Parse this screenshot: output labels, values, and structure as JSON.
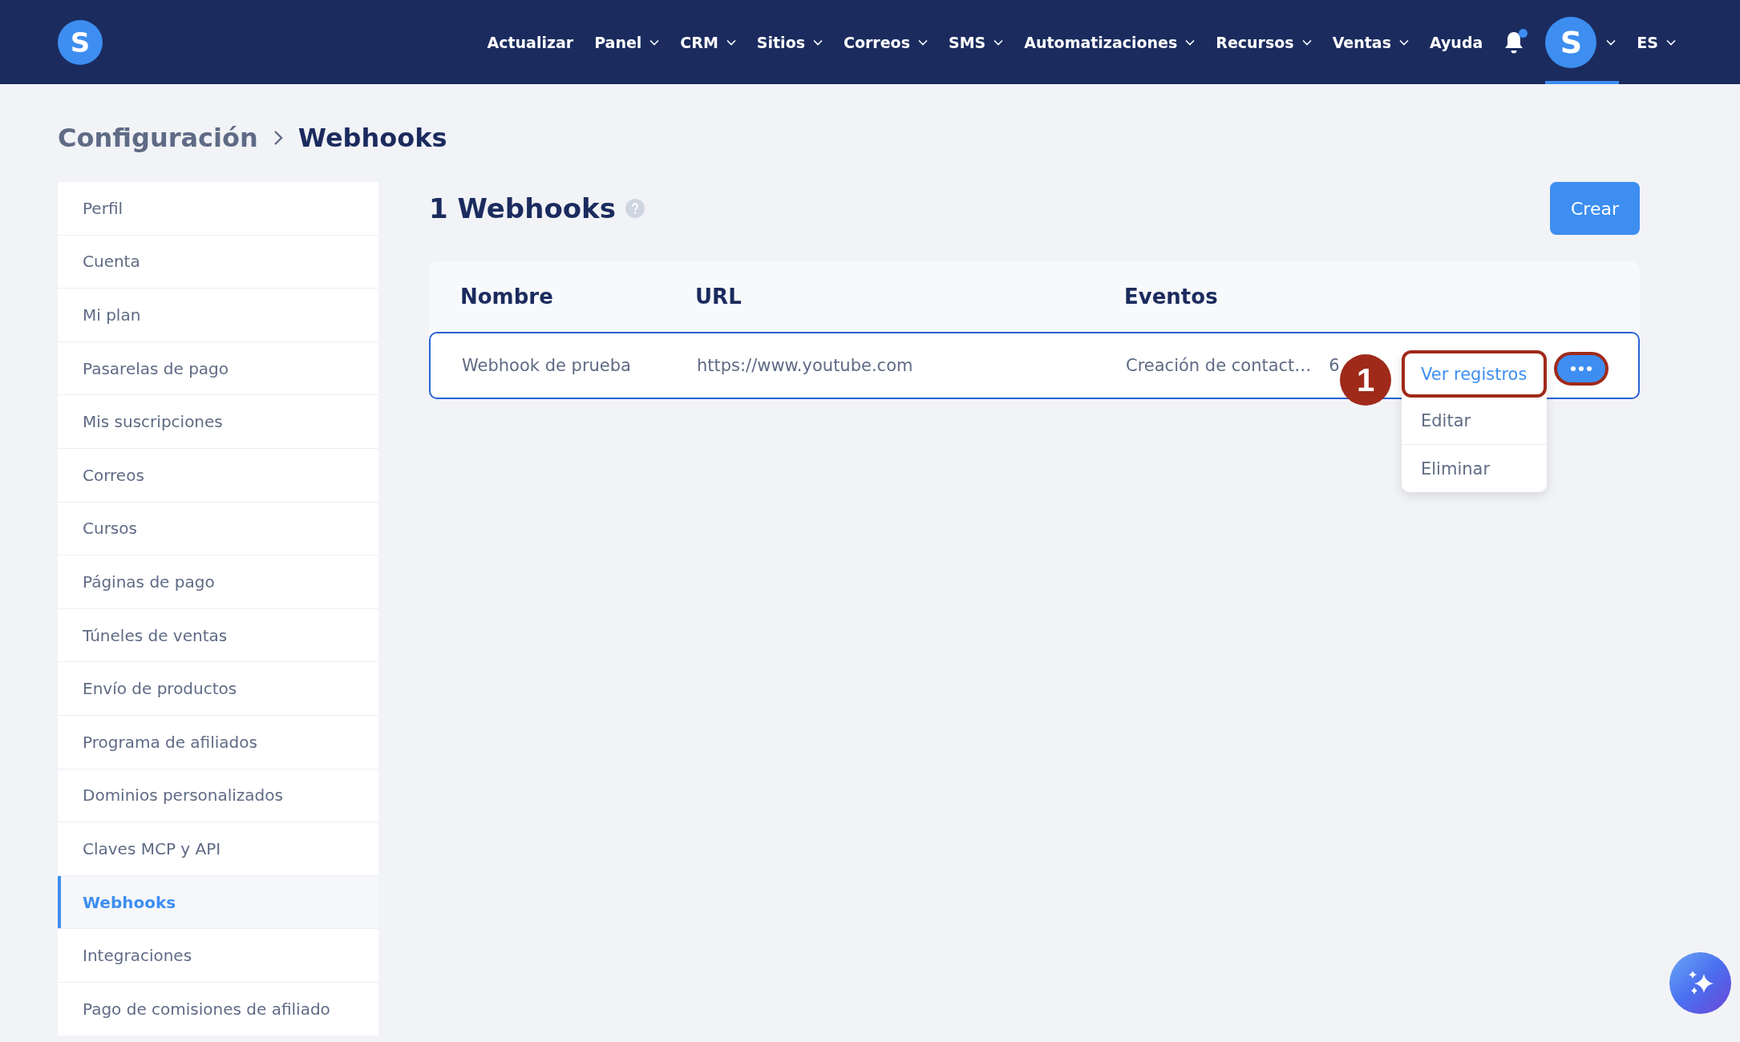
{
  "topbar": {
    "logo": "S",
    "menu": [
      {
        "label": "Actualizar",
        "dropdown": false
      },
      {
        "label": "Panel",
        "dropdown": true
      },
      {
        "label": "CRM",
        "dropdown": true
      },
      {
        "label": "Sitios",
        "dropdown": true
      },
      {
        "label": "Correos",
        "dropdown": true
      },
      {
        "label": "SMS",
        "dropdown": true
      },
      {
        "label": "Automatizaciones",
        "dropdown": true
      },
      {
        "label": "Recursos",
        "dropdown": true
      },
      {
        "label": "Ventas",
        "dropdown": true
      },
      {
        "label": "Ayuda",
        "dropdown": false
      }
    ],
    "notifications_unread": true,
    "avatar": "S",
    "language": "ES"
  },
  "breadcrumb": [
    "Configuración",
    "Webhooks"
  ],
  "sidebar": {
    "items": [
      {
        "label": "Perfil",
        "selected": false
      },
      {
        "label": "Cuenta",
        "selected": false
      },
      {
        "label": "Mi plan",
        "selected": false
      },
      {
        "label": "Pasarelas de pago",
        "selected": false
      },
      {
        "label": "Mis suscripciones",
        "selected": false
      },
      {
        "label": "Correos",
        "selected": false
      },
      {
        "label": "Cursos",
        "selected": false
      },
      {
        "label": "Páginas de pago",
        "selected": false
      },
      {
        "label": "Túneles de ventas",
        "selected": false
      },
      {
        "label": "Envío de productos",
        "selected": false
      },
      {
        "label": "Programa de afiliados",
        "selected": false
      },
      {
        "label": "Dominios personalizados",
        "selected": false
      },
      {
        "label": "Claves MCP y API",
        "selected": false
      },
      {
        "label": "Webhooks",
        "selected": true
      },
      {
        "label": "Integraciones",
        "selected": false
      },
      {
        "label": "Pago de comisiones de afiliado",
        "selected": false
      }
    ]
  },
  "main": {
    "title": "1 Webhooks",
    "create_button": "Crear",
    "table": {
      "columns": [
        "Nombre",
        "URL",
        "Eventos"
      ],
      "rows": [
        {
          "name": "Webhook de prueba",
          "url": "https://www.youtube.com",
          "events": "Creación de contact…",
          "count": "6",
          "selected": true
        }
      ]
    },
    "row_menu": {
      "items": [
        {
          "label": "Ver registros",
          "highlighted": true
        },
        {
          "label": "Editar",
          "highlighted": false
        },
        {
          "label": "Eliminar",
          "highlighted": false
        }
      ]
    },
    "step_badge": "1"
  }
}
